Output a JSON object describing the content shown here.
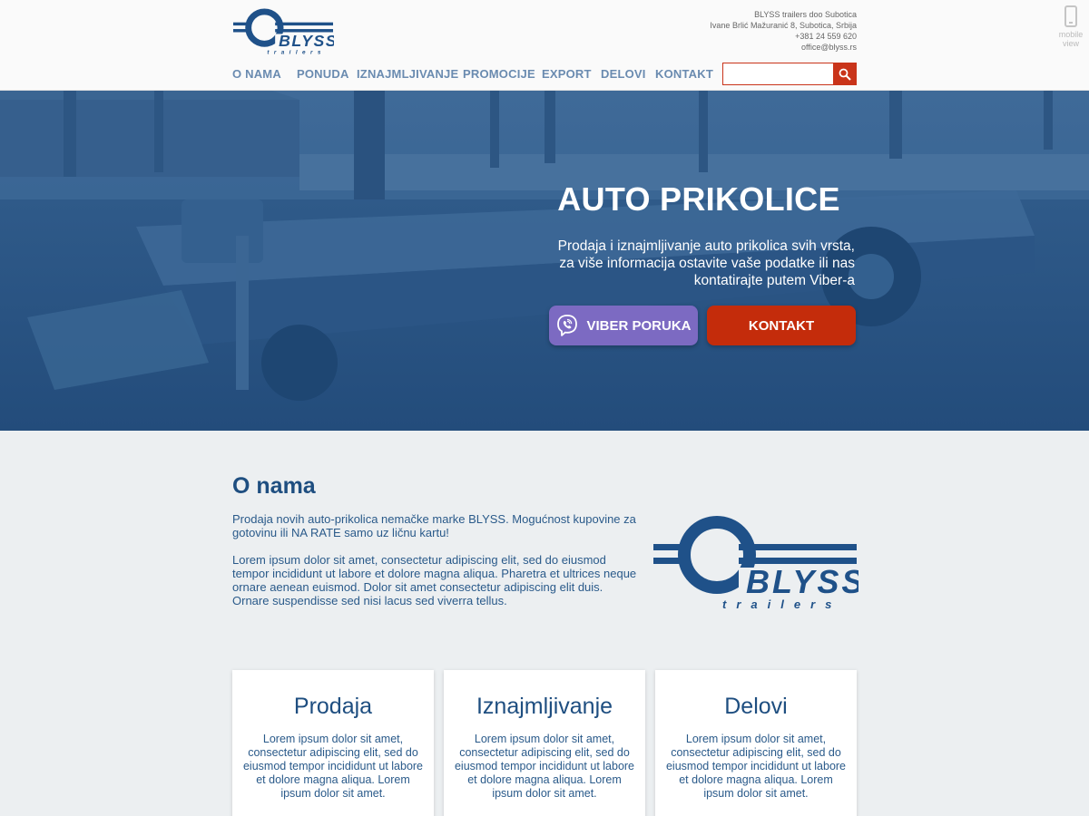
{
  "header": {
    "logo": {
      "name": "BLYSS",
      "tagline": "trailers"
    },
    "contact": {
      "company": "BLYSS trailers doo Subotica",
      "address": "Ivane Brlić Mažuranić 8, Subotica, Srbija",
      "phone": "+381 24 559 620",
      "email": "office@blyss.rs"
    },
    "mobile_view": {
      "line1": "mobile",
      "line2": "view",
      "icon": "phone-icon"
    },
    "nav": [
      {
        "label": "O NAMA"
      },
      {
        "label": "PONUDA"
      },
      {
        "label": "IZNAJMLJIVANJE"
      },
      {
        "label": "PROMOCIJE"
      },
      {
        "label": "EXPORT"
      },
      {
        "label": "DELOVI"
      },
      {
        "label": "KONTAKT"
      }
    ],
    "search": {
      "value": "",
      "placeholder": "",
      "icon": "search-icon"
    }
  },
  "hero": {
    "title": "AUTO PRIKOLICE",
    "text_lines": [
      "Prodaja i iznajmljivanje auto prikolica svih vrsta,",
      "za više informacija ostavite vaše podatke ili nas",
      "kontatirajte putem Viber-a"
    ],
    "viber_button": "VIBER PORUKA",
    "contact_button": "KONTAKT"
  },
  "about": {
    "title": "O nama",
    "paragraph1": "Prodaja novih auto-prikolica nemačke marke BLYSS. Mogućnost kupovine za gotovinu ili NA RATE samo uz ličnu kartu!",
    "paragraph2": "Lorem ipsum dolor sit amet, consectetur adipiscing elit, sed do eiusmod tempor incididunt ut labore et dolore magna aliqua. Pharetra et ultrices neque ornare aenean euismod. Dolor sit amet consectetur adipiscing elit duis. Ornare suspendisse sed nisi lacus sed viverra tellus."
  },
  "cards": [
    {
      "title": "Prodaja",
      "text": "Lorem ipsum dolor sit amet, consectetur adipiscing elit, sed do eiusmod tempor incididunt ut labore et dolore magna aliqua. Lorem ipsum dolor sit amet."
    },
    {
      "title": "Iznajmljivanje",
      "text": "Lorem ipsum dolor sit amet, consectetur adipiscing elit, sed do eiusmod tempor incididunt ut labore et dolore magna aliqua. Lorem ipsum dolor sit amet."
    },
    {
      "title": "Delovi",
      "text": "Lorem ipsum dolor sit amet, consectetur adipiscing elit, sed do eiusmod tempor incididunt ut labore et dolore magna aliqua. Lorem ipsum dolor sit amet."
    }
  ],
  "colors": {
    "brand_blue": "#1e4e80",
    "nav_text": "#6a8bb0",
    "accent_red": "#c42c0b",
    "viber_purple": "#7c6ac2",
    "hero_overlay": "#2b5989",
    "page_bg": "#eceff1"
  }
}
